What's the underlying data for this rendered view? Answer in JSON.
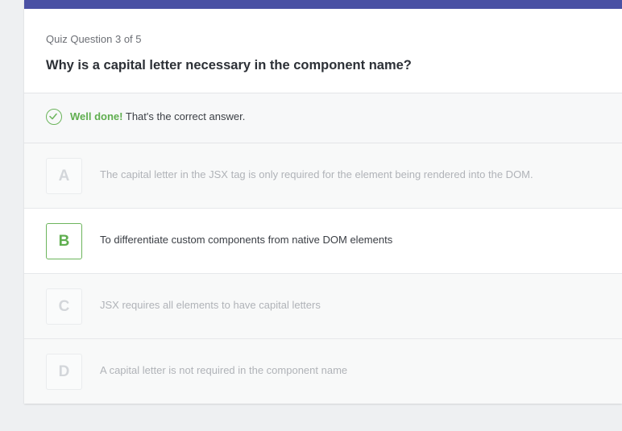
{
  "quiz": {
    "counter": "Quiz Question 3 of 5",
    "question": "Why is a capital letter necessary in the component name?"
  },
  "feedback": {
    "strong": "Well done!",
    "text": "That's the correct answer.",
    "icon": "check-circle-icon",
    "color": "#5fae4f"
  },
  "options": [
    {
      "letter": "A",
      "text": "The capital letter in the JSX tag is only required for the element being rendered into the DOM."
    },
    {
      "letter": "B",
      "text": "To differentiate custom components from native DOM elements"
    },
    {
      "letter": "C",
      "text": "JSX requires all elements to have capital letters"
    },
    {
      "letter": "D",
      "text": "A capital letter is not required in the component name"
    }
  ],
  "selected_option": "B",
  "colors": {
    "header_bar": "#4a51a4",
    "correct": "#5fae4f"
  }
}
